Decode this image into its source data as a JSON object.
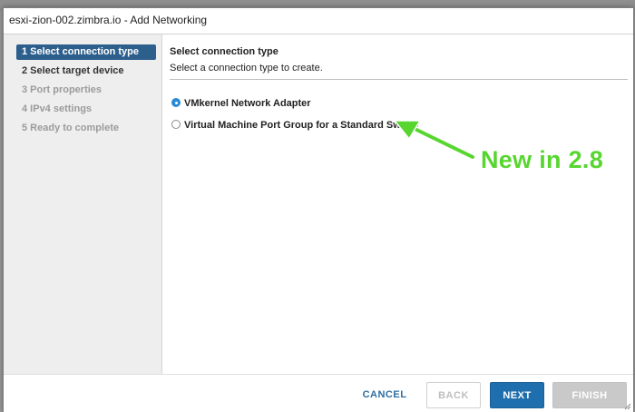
{
  "dialog": {
    "title": "esxi-zion-002.zimbra.io - Add Networking"
  },
  "wizard_steps": [
    {
      "label": "1 Select connection type",
      "state": "active"
    },
    {
      "label": "2 Select target device",
      "state": "enabled"
    },
    {
      "label": "3 Port properties",
      "state": "disabled"
    },
    {
      "label": "4 IPv4 settings",
      "state": "disabled"
    },
    {
      "label": "5 Ready to complete",
      "state": "disabled"
    }
  ],
  "content": {
    "title": "Select connection type",
    "subtitle": "Select a connection type to create.",
    "options": [
      {
        "label": "VMkernel Network Adapter",
        "checked": true
      },
      {
        "label": "Virtual Machine Port Group for a Standard Switch",
        "checked": false
      }
    ]
  },
  "annotation": {
    "text": "New in 2.8",
    "color": "#57d62f"
  },
  "footer": {
    "cancel_label": "CANCEL",
    "back_label": "BACK",
    "next_label": "NEXT",
    "finish_label": "FINISH"
  },
  "colors": {
    "accent": "#2d5f8d",
    "primary_button": "#1f6fae",
    "radio_checked": "#2b8ad6"
  }
}
